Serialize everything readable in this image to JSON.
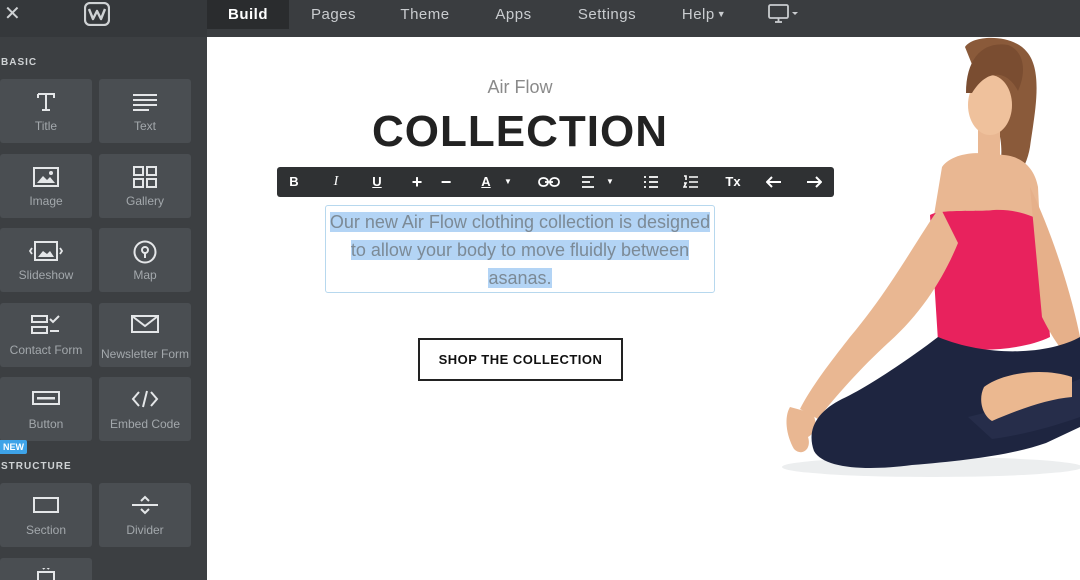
{
  "topbar": {
    "tabs": [
      {
        "label": "Build"
      },
      {
        "label": "Pages"
      },
      {
        "label": "Theme"
      },
      {
        "label": "Apps"
      },
      {
        "label": "Settings"
      },
      {
        "label": "Help"
      }
    ],
    "active_tab": "Build"
  },
  "sidebar": {
    "basic_label": "BASIC",
    "structure_label": "STRUCTURE",
    "new_badge": "NEW",
    "basic_items": [
      {
        "label": "Title",
        "icon": "title-icon"
      },
      {
        "label": "Text",
        "icon": "text-icon"
      },
      {
        "label": "Image",
        "icon": "image-icon"
      },
      {
        "label": "Gallery",
        "icon": "gallery-icon"
      },
      {
        "label": "Slideshow",
        "icon": "slideshow-icon"
      },
      {
        "label": "Map",
        "icon": "map-icon"
      },
      {
        "label": "Contact Form",
        "icon": "contact-form-icon"
      },
      {
        "label": "Newsletter Form",
        "icon": "newsletter-icon"
      },
      {
        "label": "Button",
        "icon": "button-icon"
      },
      {
        "label": "Embed Code",
        "icon": "embed-code-icon"
      }
    ],
    "structure_items": [
      {
        "label": "Section",
        "icon": "section-icon"
      },
      {
        "label": "Divider",
        "icon": "divider-icon"
      }
    ]
  },
  "canvas": {
    "subtitle": "Air Flow",
    "headline": "COLLECTION",
    "body_lines": [
      "Our new Air Flow clothing collection is designed",
      "to allow your body to move fluidly between",
      "asanas."
    ],
    "cta_label": "SHOP THE COLLECTION"
  },
  "toolbar": {
    "bold": "B",
    "italic": "I",
    "underline": "U",
    "increase": "+",
    "decrease": "−",
    "font_color": "A",
    "clear_format": "Tx"
  },
  "colors": {
    "topbar": "#3a3d40",
    "sidebar": "#3c3f42",
    "tile": "#4a4e52",
    "accent": "#3ea3e8",
    "selection": "#b3d4f5"
  }
}
